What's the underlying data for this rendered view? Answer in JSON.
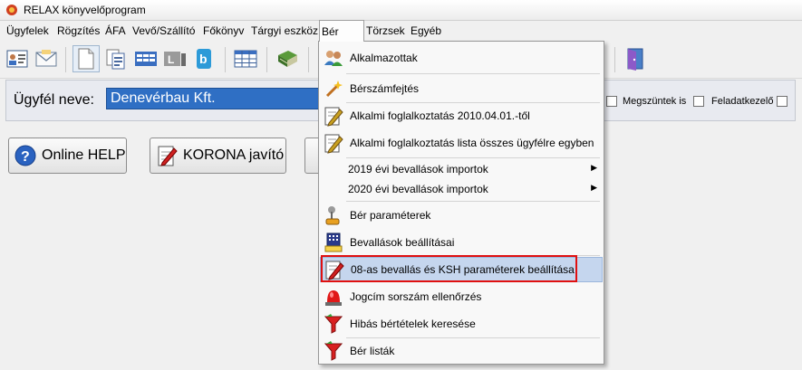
{
  "window": {
    "title": "RELAX könyvelőprogram"
  },
  "menubar": [
    "Ügyfelek",
    "Rögzítés",
    "ÁFA",
    "Vevő/Szállító",
    "Főkönyv",
    "Tárgyi eszköz",
    "Bér",
    "Törzsek",
    "Egyéb"
  ],
  "client": {
    "label": "Ügyfél neve:",
    "value": "Denevérbau Kft."
  },
  "options": {
    "closed_label": "Megszüntek is",
    "task_label": "Feladatkezelő"
  },
  "buttons": {
    "help": "Online HELP",
    "korona": "KORONA javító"
  },
  "ber_menu": {
    "items": [
      {
        "label": "Alkalmazottak",
        "icon": "people-icon"
      },
      {
        "label": "Bérszámfejtés",
        "icon": "magic-wand-icon"
      },
      {
        "label": "Alkalmi foglalkoztatás 2010.04.01.-től",
        "icon": "edit-document-icon"
      },
      {
        "label": "Alkalmi foglalkoztatás lista összes ügyfélre egyben",
        "icon": "edit-document-icon"
      },
      {
        "label": "2019 évi bevallások importok",
        "icon": ""
      },
      {
        "label": "2020 évi bevallások importok",
        "icon": ""
      },
      {
        "label": "Bér paraméterek",
        "icon": "joystick-icon"
      },
      {
        "label": "Bevallások beállításai",
        "icon": "calculator-hand-icon"
      },
      {
        "label": "08-as bevallás és KSH paraméterek beállítása",
        "icon": "edit-document-icon"
      },
      {
        "label": "Jogcím sorszám ellenőrzés",
        "icon": "alarm-light-icon"
      },
      {
        "label": "Hibás bértételek keresése",
        "icon": "filter-icon"
      },
      {
        "label": "Bér listák",
        "icon": "filter-icon"
      }
    ]
  }
}
